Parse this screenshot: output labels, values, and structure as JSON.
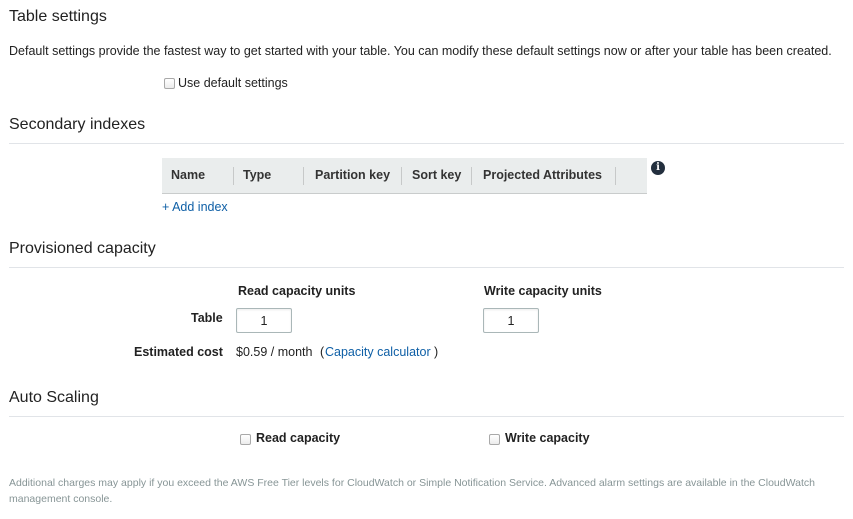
{
  "table_settings": {
    "title": "Table settings",
    "description": "Default settings provide the fastest way to get started with your table. You can modify these default settings now or after your table has been created.",
    "use_default_label": "Use default settings",
    "use_default_checked": false
  },
  "secondary_indexes": {
    "title": "Secondary indexes",
    "columns": [
      "Name",
      "Type",
      "Partition key",
      "Sort key",
      "Projected Attributes"
    ],
    "add_index_label": "+ Add index"
  },
  "provisioned_capacity": {
    "title": "Provisioned capacity",
    "read_header": "Read capacity units",
    "write_header": "Write capacity units",
    "table_label": "Table",
    "read_value": "1",
    "write_value": "1",
    "estimated_cost_label": "Estimated cost",
    "estimated_cost_value": "$0.59 / month",
    "calc_open": "(",
    "calc_link": "Capacity calculator",
    "calc_close": ")"
  },
  "auto_scaling": {
    "title": "Auto Scaling",
    "read_label": "Read capacity",
    "write_label": "Write capacity",
    "read_checked": false,
    "write_checked": false
  },
  "footnote": {
    "line1": "Additional charges may apply if you exceed the AWS Free Tier levels for CloudWatch or Simple Notification Service. Advanced alarm settings are available in the CloudWatch",
    "line2": "management console."
  },
  "icons": {
    "info": "info-icon"
  }
}
